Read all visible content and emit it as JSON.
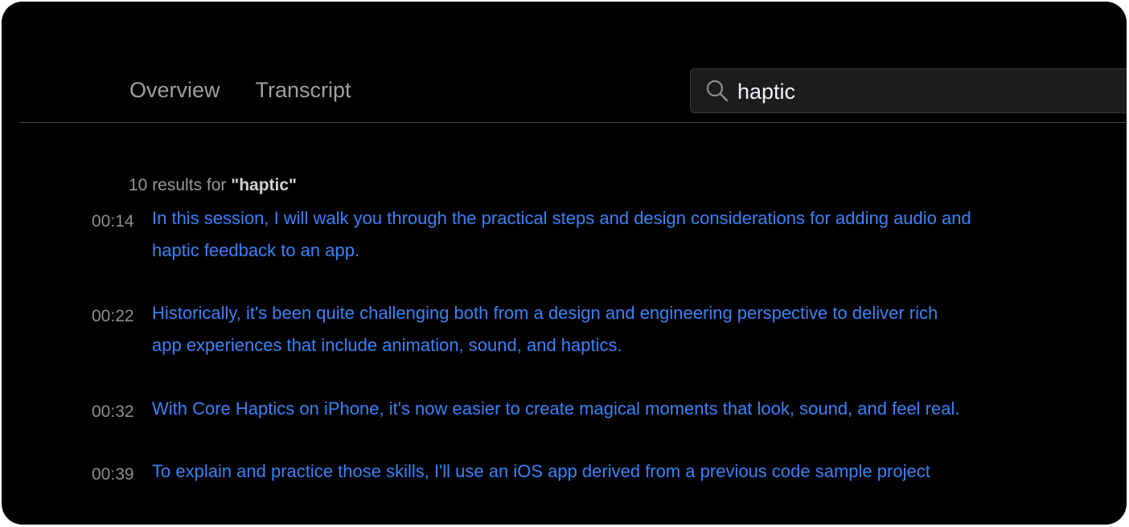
{
  "tabs": [
    "Overview",
    "Transcript"
  ],
  "search": {
    "value": "haptic",
    "icon": "search-icon"
  },
  "results": {
    "count_prefix": "10 results for ",
    "query_display": "\"haptic\""
  },
  "transcript_results": [
    {
      "time": "00:14",
      "lines": [
        "In this session, I will walk you through the practical steps and design considerations for adding audio and",
        "haptic feedback to an app."
      ]
    },
    {
      "time": "00:22",
      "lines": [
        "Historically, it's been quite challenging both from a design and engineering perspective to deliver rich",
        "app experiences that include animation, sound, and haptics."
      ]
    },
    {
      "time": "00:32",
      "lines": [
        "With Core Haptics on iPhone, it's now easier to create magical moments that look, sound, and feel real."
      ]
    },
    {
      "time": "00:39",
      "lines": [
        "To explain and practice those skills, I'll use an iOS app derived from a previous code sample project"
      ]
    }
  ],
  "colors": {
    "background": "#000000",
    "link": "#3b82f6",
    "muted": "#8e8e93"
  }
}
